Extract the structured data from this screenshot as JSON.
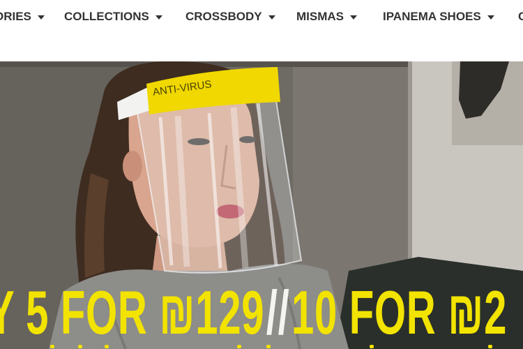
{
  "nav": {
    "items": [
      {
        "label": "ORIES"
      },
      {
        "label": "COLLECTIONS"
      },
      {
        "label": "CROSSBODY"
      },
      {
        "label": "MISMAS"
      },
      {
        "label": "IPANEMA SHOES"
      },
      {
        "label": "C"
      }
    ]
  },
  "hero": {
    "shield_text": "ANTI-VIRUS",
    "promo": {
      "part1": "Y 5 FOR ₪129",
      "separator": "//",
      "part2": "10 FOR ₪2"
    }
  },
  "colors": {
    "promo_yellow": "#f2e300",
    "shield_yellow": "#f0d800",
    "nav_text": "#333333",
    "background": "#ffffff"
  }
}
